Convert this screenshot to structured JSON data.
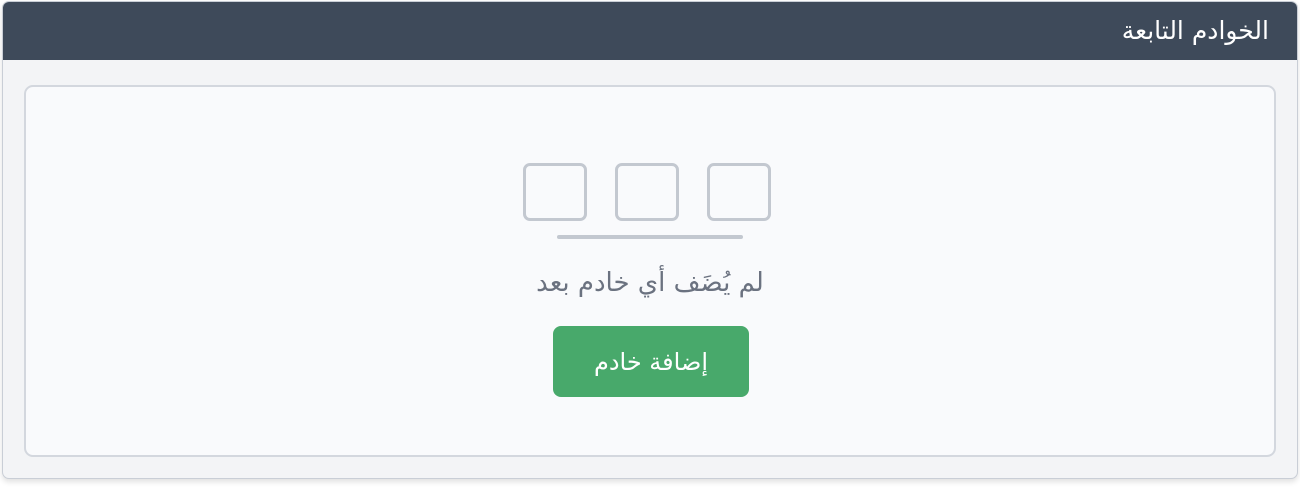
{
  "panel": {
    "title": "الخوادم التابعة"
  },
  "empty_state": {
    "message": "لم يُضَف أي خادم بعد",
    "add_button_label": "إضافة خادم"
  },
  "colors": {
    "header_bg": "#3e4a5a",
    "button_bg": "#48a96b",
    "illustration_stroke": "#c3c8d0",
    "message_text": "#6b7280"
  }
}
